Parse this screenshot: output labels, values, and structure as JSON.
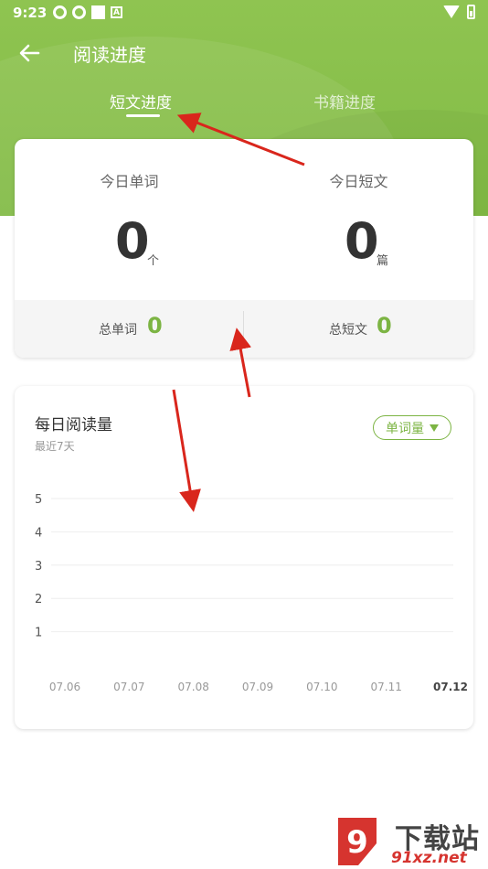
{
  "status_bar": {
    "time": "9:23",
    "badge_letter": "A"
  },
  "toolbar": {
    "title": "阅读进度"
  },
  "tabs": [
    {
      "label": "短文进度",
      "active": true
    },
    {
      "label": "书籍进度",
      "active": false
    }
  ],
  "stats": {
    "today_words_label": "今日单词",
    "today_words_value": "0",
    "today_words_unit": "个",
    "today_articles_label": "今日短文",
    "today_articles_value": "0",
    "today_articles_unit": "篇",
    "total_words_label": "总单词",
    "total_words_value": "0",
    "total_articles_label": "总短文",
    "total_articles_value": "0"
  },
  "chart": {
    "title": "每日阅读量",
    "subtitle": "最近7天",
    "dropdown_label": "单词量"
  },
  "chart_data": {
    "type": "bar",
    "title": "每日阅读量",
    "categories": [
      "07.06",
      "07.07",
      "07.08",
      "07.09",
      "07.10",
      "07.11",
      "07.12"
    ],
    "values": [
      0,
      0,
      0,
      0,
      0,
      0,
      0
    ],
    "yticks": [
      "1",
      "2",
      "3",
      "4",
      "5"
    ],
    "ylim": [
      0,
      5
    ],
    "grid": true,
    "highlight_category": "07.12"
  },
  "colors": {
    "header_green": "#86be49",
    "accent_green": "#7cb443",
    "annotation_red": "#d9261c"
  },
  "watermark": {
    "brand": "下载站",
    "url": "91xz.net"
  }
}
